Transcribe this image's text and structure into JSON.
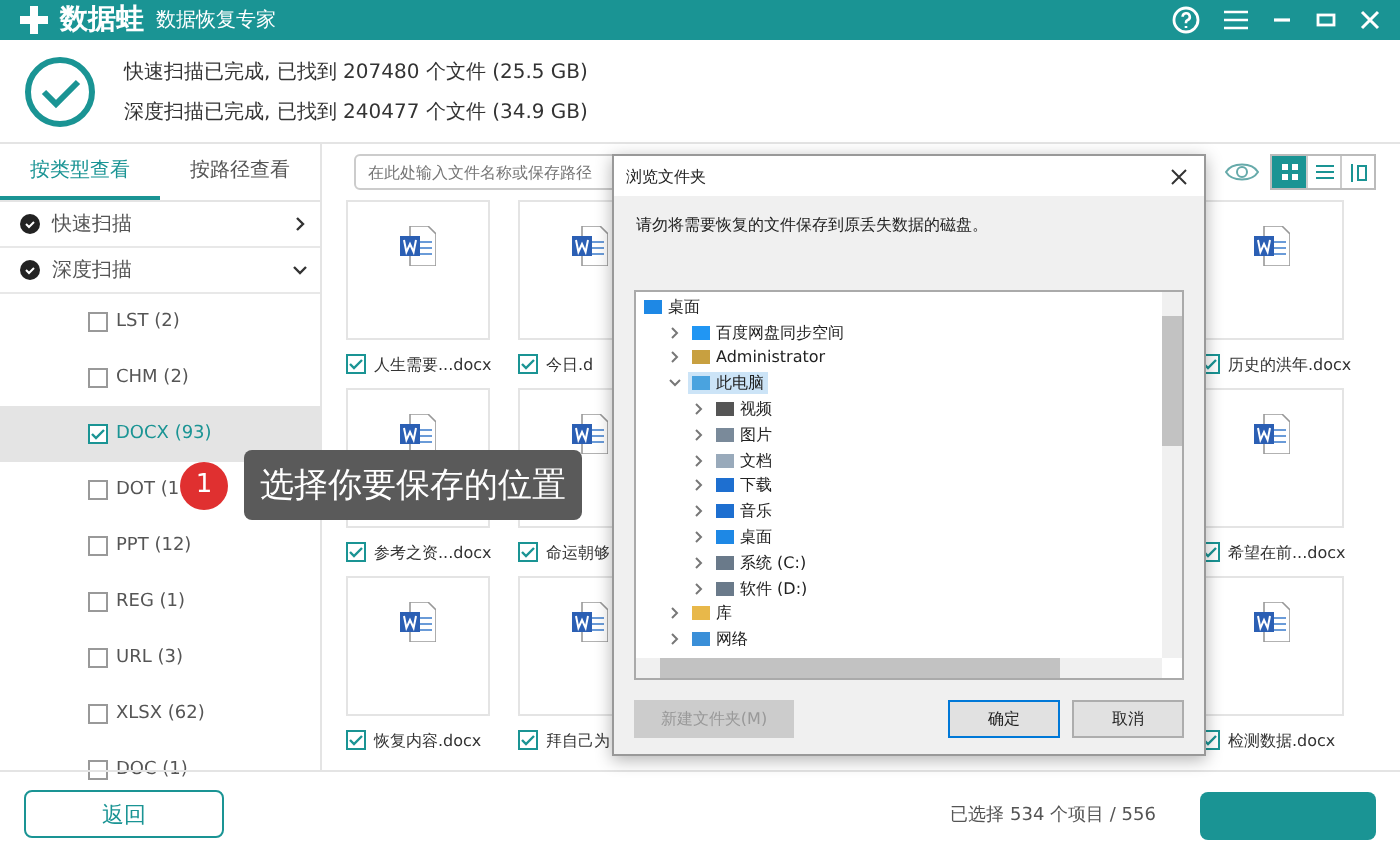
{
  "app": {
    "name": "数据蛙",
    "subtitle": "数据恢复专家"
  },
  "summary": [
    "快速扫描已完成, 已找到 207480 个文件 (25.5 GB)",
    "深度扫描已完成, 已找到 240477 个文件 (34.9 GB)"
  ],
  "tabs": [
    {
      "label": "按类型查看",
      "selected": true
    },
    {
      "label": "按路径查看",
      "selected": false
    }
  ],
  "sidebar": [
    {
      "label": "快速扫描",
      "expanded": false
    },
    {
      "label": "深度扫描",
      "expanded": true,
      "children": [
        {
          "label": "LST (2)",
          "checked": false,
          "selected": false
        },
        {
          "label": "CHM (2)",
          "checked": false,
          "selected": false
        },
        {
          "label": "DOCX (93)",
          "checked": true,
          "selected": true
        },
        {
          "label": "DOT (1",
          "checked": false,
          "selected": false
        },
        {
          "label": "PPT (12)",
          "checked": false,
          "selected": false
        },
        {
          "label": "REG (1)",
          "checked": false,
          "selected": false
        },
        {
          "label": "URL (3)",
          "checked": false,
          "selected": false
        },
        {
          "label": "XLSX (62)",
          "checked": false,
          "selected": false
        },
        {
          "label": "DOC (1)",
          "checked": false,
          "selected": false
        }
      ]
    }
  ],
  "search": {
    "placeholder": "在此处输入文件名称或保存路径"
  },
  "views": [
    {
      "kind": "grid",
      "selected": true
    },
    {
      "kind": "list",
      "selected": false
    },
    {
      "kind": "columns",
      "selected": false
    }
  ],
  "files": [
    [
      {
        "name": "人生需要...docx",
        "checked": true
      },
      {
        "name": "今日.d",
        "checked": true
      },
      {
        "name": "历史的洪年.docx",
        "checked": true
      }
    ],
    [
      {
        "name": "参考之资...docx",
        "checked": true
      },
      {
        "name": "命运朝够",
        "checked": true
      },
      {
        "name": "希望在前...docx",
        "checked": true
      }
    ],
    [
      {
        "name": "恢复内容.docx",
        "checked": true
      },
      {
        "name": "拜自己为",
        "checked": true
      },
      {
        "name": "检测数据.docx",
        "checked": true
      }
    ]
  ],
  "tooltip": {
    "step": "1",
    "text": "选择你要保存的位置"
  },
  "dialog": {
    "title": "浏览文件夹",
    "message": "请勿将需要恢复的文件保存到原丢失数据的磁盘。",
    "tree": [
      {
        "label": "桌面",
        "selected": false,
        "children": [
          {
            "label": "百度网盘同步空间",
            "expanded": false,
            "selected": false
          },
          {
            "label": "Administrator",
            "expanded": false,
            "selected": false
          },
          {
            "label": "此电脑",
            "expanded": true,
            "selected": true,
            "children": [
              {
                "label": "视频",
                "expanded": false,
                "selected": false
              },
              {
                "label": "图片",
                "expanded": false,
                "selected": false
              },
              {
                "label": "文档",
                "expanded": false,
                "selected": false
              },
              {
                "label": "下载",
                "expanded": false,
                "selected": false
              },
              {
                "label": "音乐",
                "expanded": false,
                "selected": false
              },
              {
                "label": "桌面",
                "expanded": false,
                "selected": false
              },
              {
                "label": "系统 (C:)",
                "expanded": false,
                "selected": false
              },
              {
                "label": "软件 (D:)",
                "expanded": false,
                "selected": false
              }
            ]
          },
          {
            "label": "库",
            "expanded": false,
            "selected": false
          },
          {
            "label": "网络",
            "expanded": false,
            "selected": false
          }
        ]
      }
    ],
    "buttons": [
      {
        "label": "新建文件夹(M)",
        "disabled": true,
        "default": false
      },
      {
        "label": "确定",
        "disabled": false,
        "default": true
      },
      {
        "label": "取消",
        "disabled": false,
        "default": false
      }
    ]
  },
  "footer": {
    "back": "返回",
    "status": "已选择 534 个项目 / 556"
  }
}
